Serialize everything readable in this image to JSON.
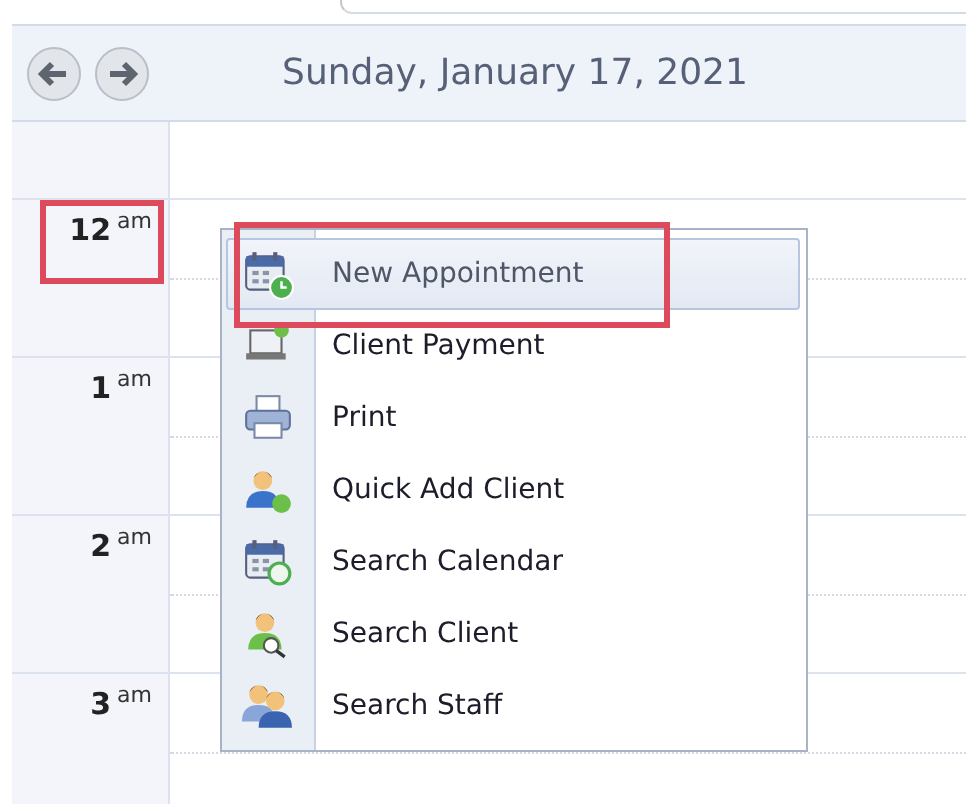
{
  "header": {
    "title": "Sunday, January 17, 2021"
  },
  "hours": [
    {
      "hour": "12",
      "suffix": "am",
      "highlighted": true
    },
    {
      "hour": "1",
      "suffix": "am",
      "highlighted": false
    },
    {
      "hour": "2",
      "suffix": "am",
      "highlighted": false
    },
    {
      "hour": "3",
      "suffix": "am",
      "highlighted": false
    }
  ],
  "context_menu": {
    "items": [
      {
        "label": "New Appointment",
        "selected": true,
        "highlighted": true
      },
      {
        "label": "Client Payment",
        "selected": false,
        "highlighted": false
      },
      {
        "label": "Print",
        "selected": false,
        "highlighted": false
      },
      {
        "label": "Quick Add Client",
        "selected": false,
        "highlighted": false
      },
      {
        "label": "Search Calendar",
        "selected": false,
        "highlighted": false
      },
      {
        "label": "Search Client",
        "selected": false,
        "highlighted": false
      },
      {
        "label": "Search Staff",
        "selected": false,
        "highlighted": false
      }
    ]
  }
}
